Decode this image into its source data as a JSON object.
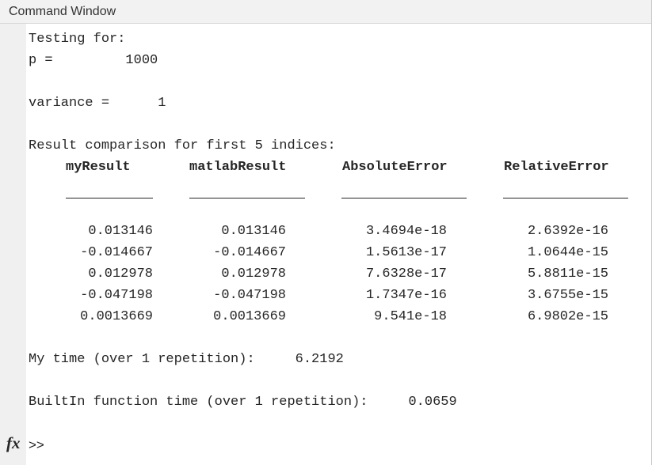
{
  "window": {
    "title": "Command Window"
  },
  "output": {
    "testing_label": "Testing for:",
    "p_line": "p =         1000",
    "variance_line": "variance =      1",
    "comparison_label": "Result comparison for first 5 indices:",
    "my_time_line": "My time (over 1 repetition):     6.2192",
    "builtin_time_line": "BuiltIn function time (over 1 repetition):     0.0659"
  },
  "table": {
    "headers": [
      "myResult",
      "matlabResult",
      "AbsoluteError",
      "RelativeError"
    ],
    "rows": [
      [
        "0.013146",
        "0.013146",
        "3.4694e-18",
        "2.6392e-16"
      ],
      [
        "-0.014667",
        "-0.014667",
        "1.5613e-17",
        "1.0644e-15"
      ],
      [
        "0.012978",
        "0.012978",
        "7.6328e-17",
        "5.8811e-15"
      ],
      [
        "-0.047198",
        "-0.047198",
        "1.7347e-16",
        "3.6755e-15"
      ],
      [
        "0.0013669",
        "0.0013669",
        "9.541e-18",
        "6.9802e-15"
      ]
    ]
  },
  "prompt": {
    "fx_icon": "fx",
    "symbol": ">>"
  }
}
